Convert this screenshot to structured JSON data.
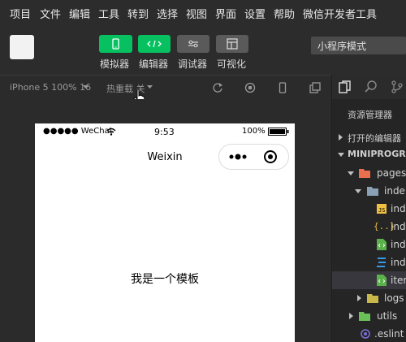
{
  "menu": [
    "项目",
    "文件",
    "编辑",
    "工具",
    "转到",
    "选择",
    "视图",
    "界面",
    "设置",
    "帮助",
    "微信开发者工具"
  ],
  "toolbar": {
    "simulator_label": "模拟器",
    "editor_label": "编辑器",
    "debugger_label": "调试器",
    "visualize_label": "可视化",
    "mode_value": "小程序模式"
  },
  "simbar": {
    "device": "iPhone 5 100% 16",
    "hot_reload": "热重载 关"
  },
  "phone": {
    "signal": "●●●●● WeChat",
    "time": "9:53",
    "battery": "100%",
    "nav_title": "Weixin",
    "page_text": "我是一个模板"
  },
  "explorer": {
    "title": "资源管理器",
    "open_editors": "打开的编辑器",
    "project": "MINIPROGRA",
    "tree": [
      "pages",
      "inde",
      "ind",
      "ind",
      "ind",
      "ind",
      "iten",
      "logs",
      "utils",
      ".eslint"
    ]
  },
  "colors": {
    "accent_green": "#07c160",
    "gray_button": "#5a5a5a",
    "background": "#2b2b2b"
  }
}
